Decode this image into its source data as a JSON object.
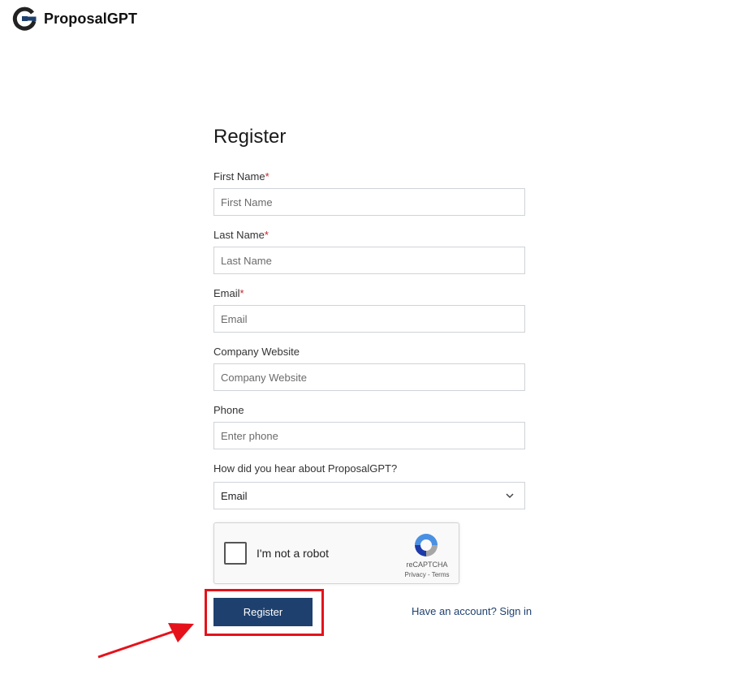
{
  "brand": {
    "name": "ProposalGPT"
  },
  "form": {
    "title": "Register",
    "required_mark": "*",
    "fields": {
      "first_name": {
        "label": "First Name",
        "placeholder": "First Name",
        "value": ""
      },
      "last_name": {
        "label": "Last Name",
        "placeholder": "Last Name",
        "value": ""
      },
      "email": {
        "label": "Email",
        "placeholder": "Email",
        "value": ""
      },
      "website": {
        "label": "Company Website",
        "placeholder": "Company Website",
        "value": ""
      },
      "phone": {
        "label": "Phone",
        "placeholder": "Enter phone",
        "value": ""
      },
      "source": {
        "label": "How did you hear about ProposalGPT?",
        "selected": "Email"
      }
    },
    "captcha": {
      "label": "I'm not a robot",
      "brand": "reCAPTCHA",
      "links": "Privacy - Terms"
    },
    "submit_label": "Register",
    "signin_link": "Have an account? Sign in"
  },
  "colors": {
    "primary": "#1e406e",
    "required": "#c0272d",
    "highlight": "#e5121b"
  },
  "icons": [
    "proposalgpt-logo-icon",
    "chevron-down-icon",
    "recaptcha-icon",
    "red-arrow-annotation-icon"
  ]
}
